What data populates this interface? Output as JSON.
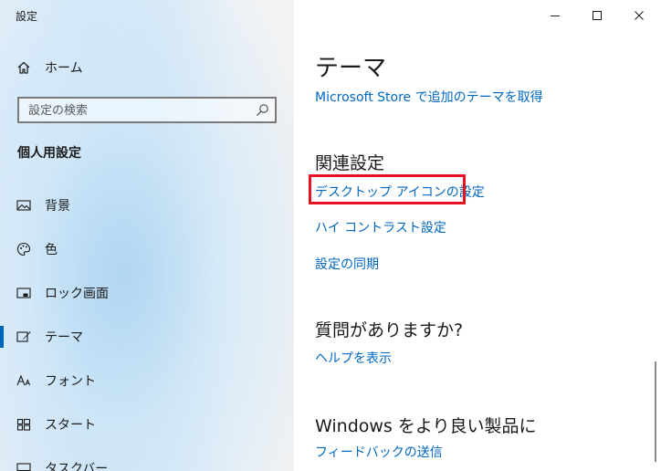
{
  "window": {
    "title": "設定"
  },
  "sidebar": {
    "home_label": "ホーム",
    "search_placeholder": "設定の検索",
    "section_heading": "個人用設定",
    "items": [
      {
        "label": "背景",
        "icon": "picture-icon"
      },
      {
        "label": "色",
        "icon": "palette-icon"
      },
      {
        "label": "ロック画面",
        "icon": "lock-screen-icon"
      },
      {
        "label": "テーマ",
        "icon": "theme-brush-icon",
        "selected": true
      },
      {
        "label": "フォント",
        "icon": "font-icon"
      },
      {
        "label": "スタート",
        "icon": "start-grid-icon"
      },
      {
        "label": "タスクバー",
        "icon": "taskbar-icon"
      }
    ]
  },
  "main": {
    "title": "テーマ",
    "store_link": "Microsoft Store で追加のテーマを取得",
    "related_heading": "関連設定",
    "related_links": [
      "デスクトップ アイコンの設定",
      "ハイ コントラスト設定",
      "設定の同期"
    ],
    "question_heading": "質問がありますか?",
    "help_link": "ヘルプを表示",
    "improve_heading": "Windows をより良い製品に",
    "feedback_link": "フィードバックの送信"
  },
  "colors": {
    "accent": "#0067c0",
    "highlight_border": "#e81123",
    "text": "#1a1a1a"
  }
}
